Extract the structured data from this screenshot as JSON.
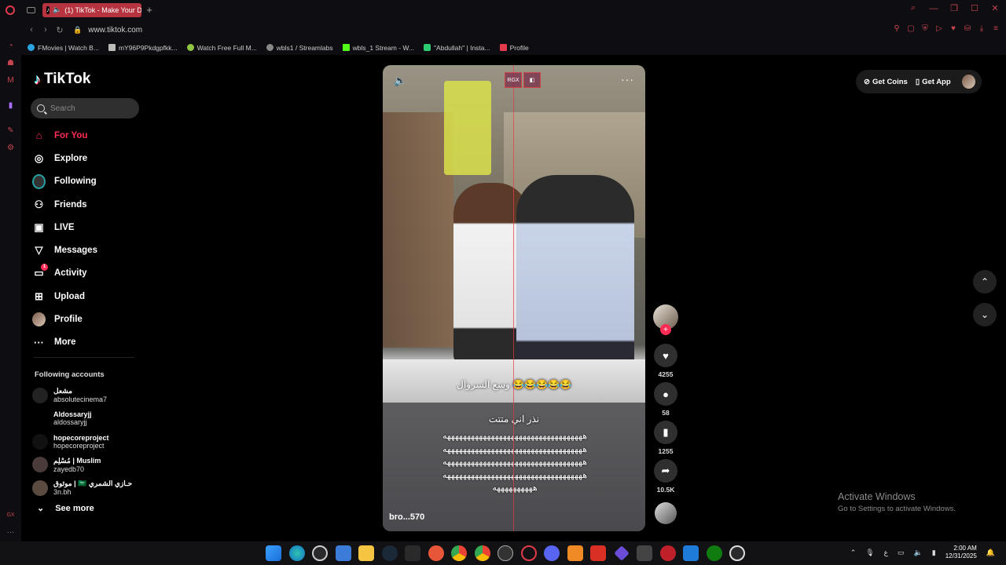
{
  "browser": {
    "tab_title": "(1) TikTok - Make Your Day",
    "url": "www.tiktok.com",
    "new_tab": "+",
    "bookmarks": [
      {
        "label": "FMovies | Watch B...",
        "color": "#2aa3e0"
      },
      {
        "label": "mY96P9Pkdgpfkk...",
        "color": "#bbbbbb"
      },
      {
        "label": "Watch Free Full M...",
        "color": "#8ec63f"
      },
      {
        "label": "wbls1 / Streamlabs",
        "color": "#888888"
      },
      {
        "label": "wbls_1 Stream - W...",
        "color": "#53fc18"
      },
      {
        "label": "\"Abdullah\" | Insta...",
        "color": "#2ecc71"
      },
      {
        "label": "Profile",
        "color": "#e23a4a"
      }
    ]
  },
  "sidebar": {
    "logo": "TikTok",
    "search_placeholder": "Search",
    "nav": [
      {
        "label": "For You",
        "icon": "home-icon",
        "glyph": "⌂",
        "active": true
      },
      {
        "label": "Explore",
        "icon": "compass-icon",
        "glyph": "◎"
      },
      {
        "label": "Following",
        "icon": "following-avatar-icon",
        "glyph": ""
      },
      {
        "label": "Friends",
        "icon": "friends-icon",
        "glyph": "⚇"
      },
      {
        "label": "LIVE",
        "icon": "live-icon",
        "glyph": "▣"
      },
      {
        "label": "Messages",
        "icon": "messages-icon",
        "glyph": "▽"
      },
      {
        "label": "Activity",
        "icon": "activity-icon",
        "glyph": "▭",
        "badge": "1"
      },
      {
        "label": "Upload",
        "icon": "upload-icon",
        "glyph": "⊞"
      },
      {
        "label": "Profile",
        "icon": "profile-avatar-icon",
        "glyph": ""
      },
      {
        "label": "More",
        "icon": "more-icon",
        "glyph": "···"
      }
    ],
    "following_title": "Following accounts",
    "following": [
      {
        "name": "مشعل",
        "handle": "absolutecinema7"
      },
      {
        "name": "Aldossaryjj",
        "handle": "aldossaryjj"
      },
      {
        "name": "hopecoreproject",
        "handle": "hopecoreproject"
      },
      {
        "name": "مُسْلِم | Muslim",
        "handle": "zayedb70"
      },
      {
        "name": "موثوق | 🇸🇦 حـازي الشمري",
        "handle": "3n.bh"
      }
    ],
    "see_more": "See more"
  },
  "video": {
    "caption_top": "وسع السروال 😂😂😂😂😂",
    "caption_mid": "نذر اني متتت",
    "laugh_lines": [
      "هههههههههههههههههههههههههههههههههههه",
      "هههههههههههههههههههههههههههههههههههه",
      "هههههههههههههههههههههههههههههههههههه",
      "هههههههههههههههههههههههههههههههههههه",
      "ههههههههههه"
    ],
    "author": "bro...570",
    "rgx_label": "RGX",
    "likes": "4255",
    "comments": "58",
    "saves": "1255",
    "shares": "10.5K"
  },
  "topbar": {
    "get_coins": "Get Coins",
    "get_app": "Get App"
  },
  "watermark": {
    "line1": "Activate Windows",
    "line2": "Go to Settings to activate Windows."
  },
  "taskbar": {
    "time": "2:00 AM",
    "date": "12/31/2025",
    "lang": "ع"
  }
}
